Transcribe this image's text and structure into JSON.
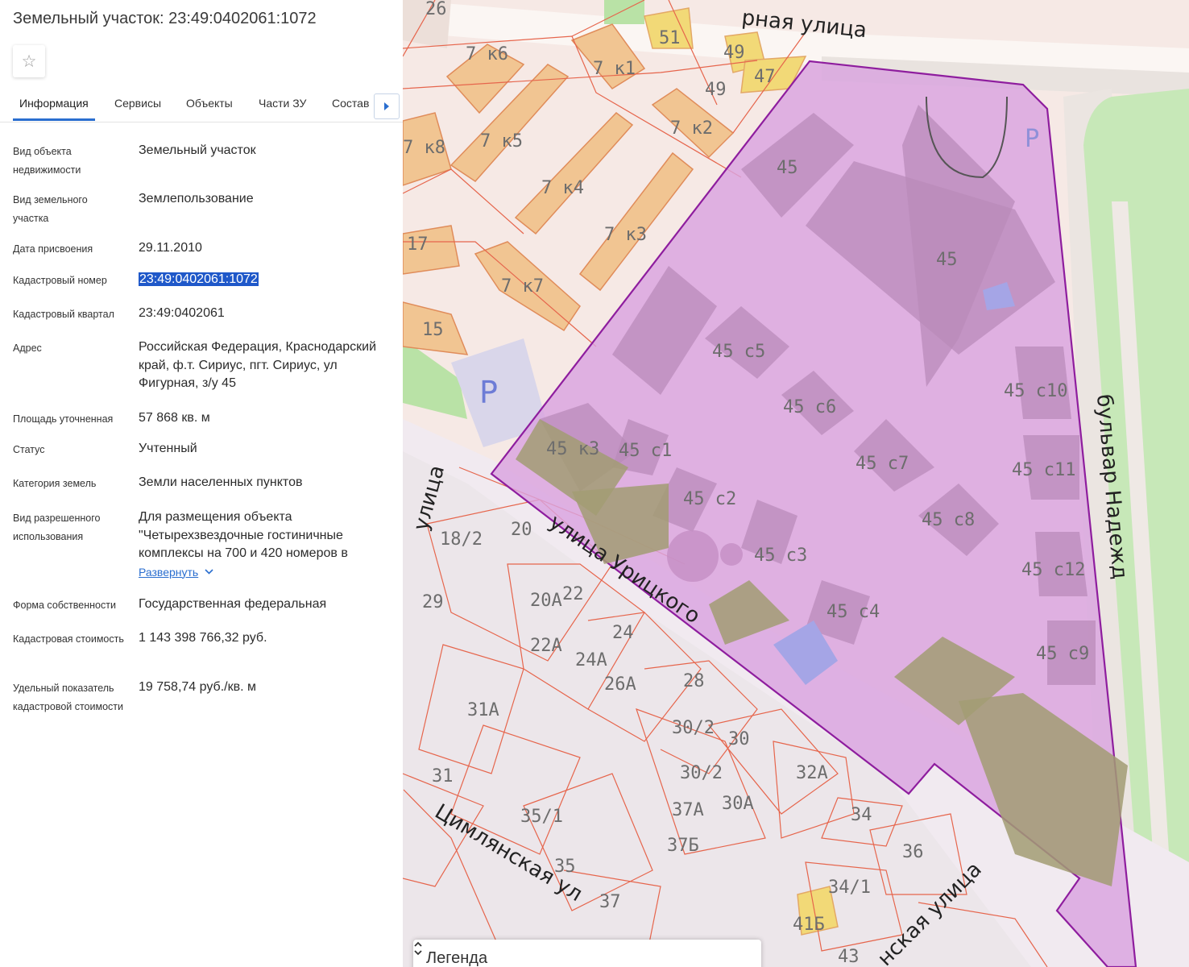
{
  "panel": {
    "title": "Земельный участок: 23:49:0402061:1072",
    "tabs": [
      "Информация",
      "Сервисы",
      "Объекты",
      "Части ЗУ",
      "Состав"
    ],
    "fields": [
      {
        "label": "Вид объекта недвижимости",
        "value": "Земельный участок"
      },
      {
        "label": "Вид земельного участка",
        "value": "Землепользование"
      },
      {
        "label": "Дата присвоения",
        "value": "29.11.2010"
      },
      {
        "label": "Кадастровый номер",
        "value": "23:49:0402061:1072"
      },
      {
        "label": "Кадастровый квартал",
        "value": "23:49:0402061"
      },
      {
        "label": "Адрес",
        "value": "Российская Федерация, Краснодарский край, ф.т. Сириус, пгт. Сириус, ул Фигурная, з/у 45"
      },
      {
        "label": "Площадь уточненная",
        "value": "57 868 кв. м"
      },
      {
        "label": "Статус",
        "value": "Учтенный"
      },
      {
        "label": "Категория земель",
        "value": "Земли населенных пунктов"
      },
      {
        "label": "Вид разрешенного использования",
        "value": "Для размещения объекта \"Четырехзвездочные гостиничные комплексы на 700 и 420 номеров в",
        "expand": "Развернуть"
      },
      {
        "label": "Форма собственности",
        "value": "Государственная федеральная"
      },
      {
        "label": "Кадастровая стоимость",
        "value": "1 143 398 766,32 руб."
      },
      {
        "label": "Удельный показатель кадастровой стоимости",
        "value": "19 758,74 руб./кв. м"
      }
    ]
  },
  "map": {
    "streets": [
      "рная улица",
      "улица Урицкого",
      "бульвар Надежд",
      "улица",
      "Цимлянская ул",
      "нская улица"
    ],
    "labels": [
      "26",
      "51",
      "49",
      "49",
      "47",
      "7 к6",
      "7 к1",
      "7 к5",
      "7 к8",
      "7 к2",
      "7 к4",
      "7 к3",
      "17",
      "7 к7",
      "15",
      "P",
      "45",
      "45",
      "P",
      "45 с5",
      "45 с6",
      "45 с10",
      "45 к3",
      "45 с1",
      "45 с7",
      "45 с11",
      "45 с2",
      "45 с8",
      "45 с3",
      "45 с12",
      "45 с4",
      "45 с9",
      "18/2",
      "20",
      "20А",
      "22",
      "29",
      "24",
      "22А",
      "24А",
      "26А",
      "28",
      "31А",
      "30/2",
      "30",
      "30/2",
      "32А",
      "31",
      "30А",
      "37А",
      "34",
      "35/1",
      "37Б",
      "36",
      "35",
      "34/1",
      "37",
      "41Б",
      "43"
    ],
    "legend": "Легенда"
  },
  "colors": {
    "parcel_fill": "#d9a4df",
    "parcel_border": "#8e1d9e",
    "accent": "#2a6ecf",
    "selection": "#1f58c9"
  }
}
